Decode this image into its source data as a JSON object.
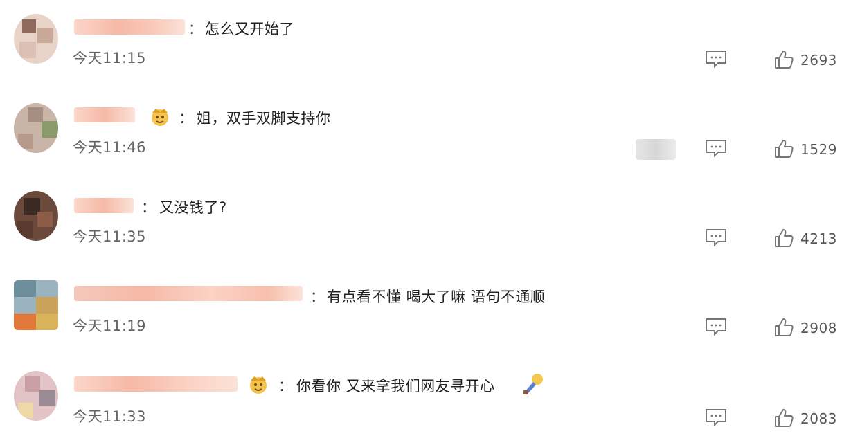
{
  "comments": [
    {
      "text": "怎么又开始了",
      "time": "今天11:15",
      "likes": "2693"
    },
    {
      "text": "姐，双手双脚支持你",
      "time": "今天11:46",
      "likes": "1529"
    },
    {
      "text": "又没钱了?",
      "time": "今天11:35",
      "likes": "4213"
    },
    {
      "text": "有点看不懂 喝大了嘛 语句不通顺",
      "time": "今天11:19",
      "likes": "2908"
    },
    {
      "text": "你看你 又来拿我们网友寻开心",
      "time": "今天11:33",
      "likes": "2083"
    }
  ],
  "separator": "：",
  "icons": {
    "reply": "comment-icon",
    "like": "thumbs-up-icon",
    "badge": "crown-emoji-icon",
    "emoji": "microphone-emoji-icon"
  },
  "colors": {
    "name_blur": "#f6b9a6",
    "text": "#222222",
    "meta": "#666666",
    "icon": "#777777"
  }
}
